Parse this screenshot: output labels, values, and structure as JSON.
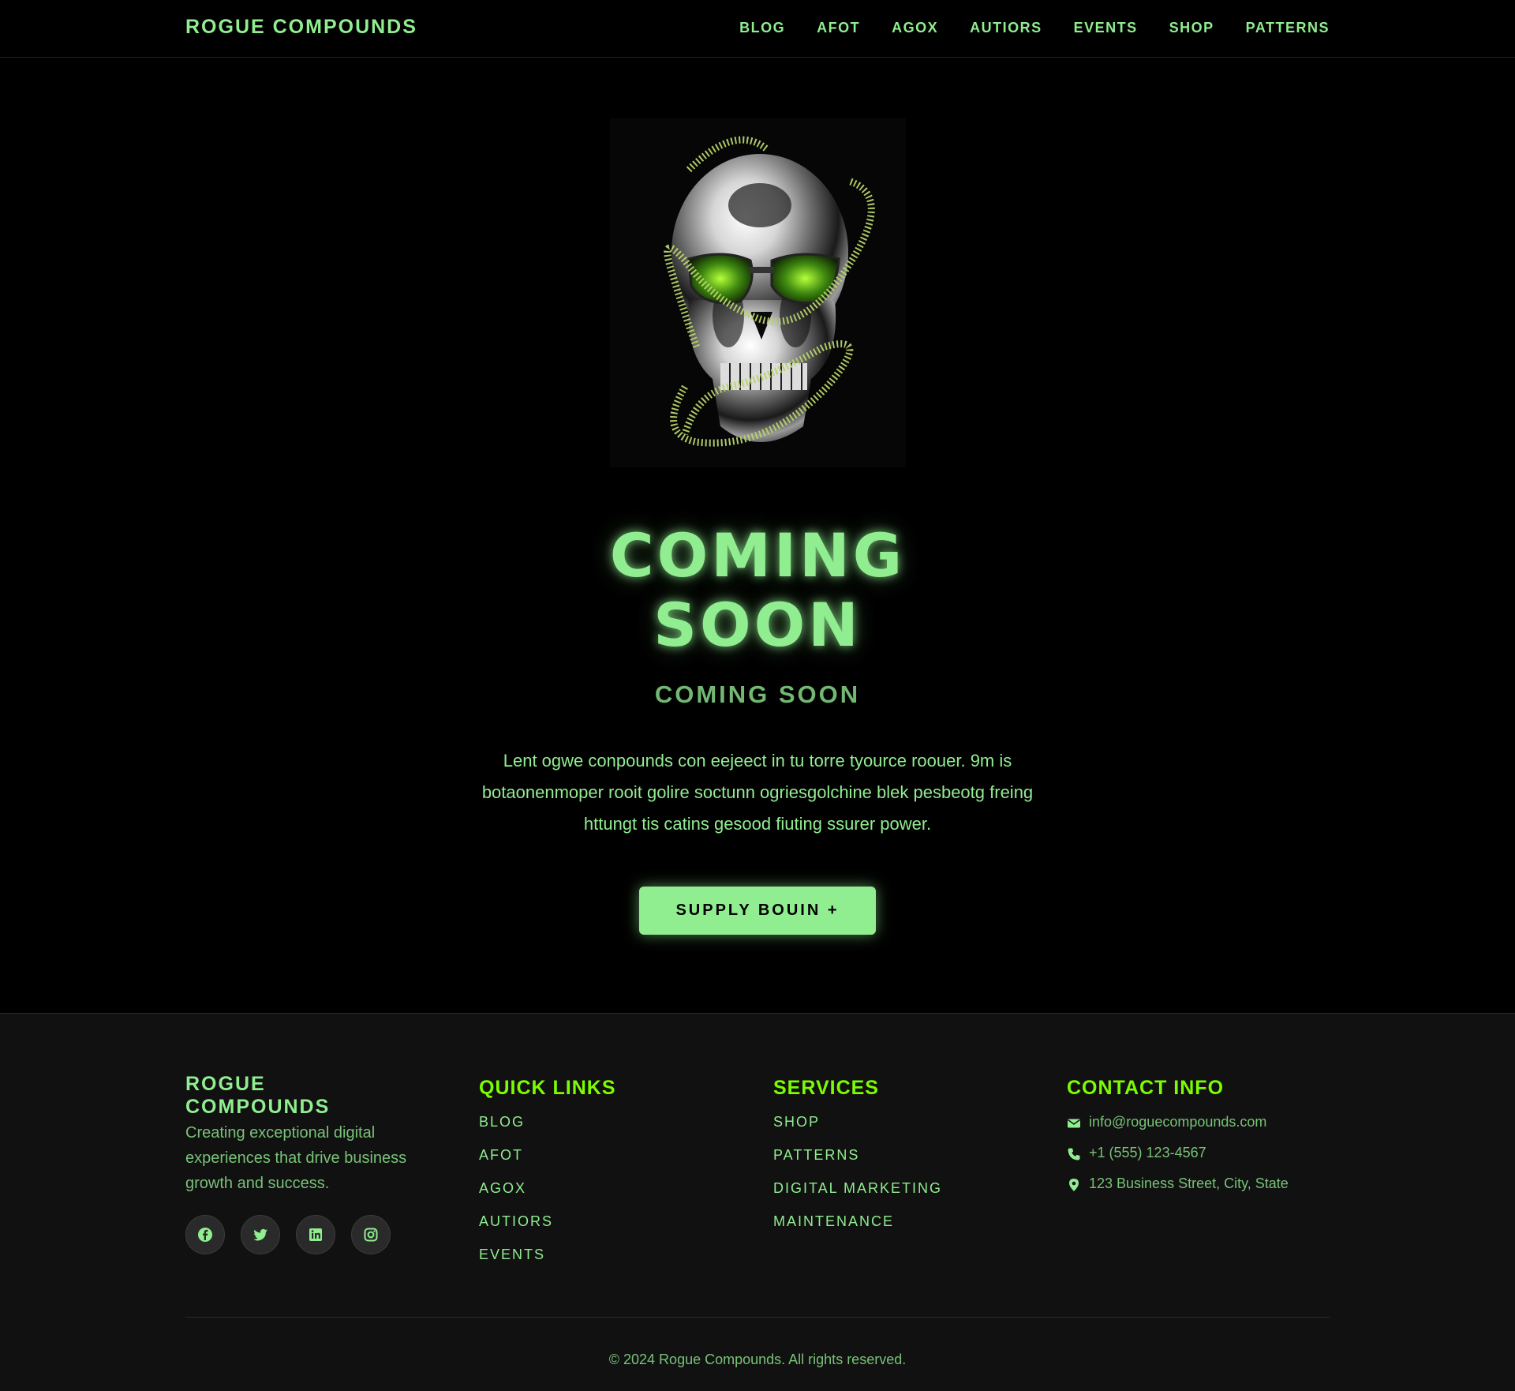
{
  "header": {
    "brand": "ROGUE COMPOUNDS",
    "nav": [
      "BLOG",
      "AFOT",
      "AGOX",
      "AUTIORS",
      "EVENTS",
      "SHOP",
      "PATTERNS"
    ]
  },
  "hero": {
    "image_icon": "chrome-skull-icon",
    "title_line1": "COMING",
    "title_line2": "SOON",
    "subtitle": "COMING SOON",
    "text": "Lent ogwe conpounds con eejeect in tu torre tyource roouer. 9m is botaonenmoper rooit golire soctunn ogriesgolchine blek pesbeotg freing httungt tis catins gesood fiuting ssurer power.",
    "cta_label": "SUPPLY BOUIN +"
  },
  "footer": {
    "brand": "ROGUE COMPOUNDS",
    "tagline": "Creating exceptional digital experiences that drive business growth and success.",
    "socials": [
      "facebook-icon",
      "twitter-icon",
      "linkedin-icon",
      "instagram-icon"
    ],
    "quick_links": {
      "heading": "QUICK LINKS",
      "items": [
        "BLOG",
        "AFOT",
        "AGOX",
        "AUTIORS",
        "EVENTS"
      ]
    },
    "services": {
      "heading": "SERVICES",
      "items": [
        "SHOP",
        "PATTERNS",
        "DIGITAL MARKETING",
        "MAINTENANCE"
      ]
    },
    "contact": {
      "heading": "CONTACT INFO",
      "email": "info@roguecompounds.com",
      "phone": "+1 (555) 123-4567",
      "address": "123 Business Street, City, State"
    },
    "copyright": "© 2024 Rogue Compounds. All rights reserved."
  },
  "colors": {
    "accent": "#90ee90",
    "heading_accent": "#7cfc00",
    "background": "#000000",
    "footer_background": "#111111"
  }
}
